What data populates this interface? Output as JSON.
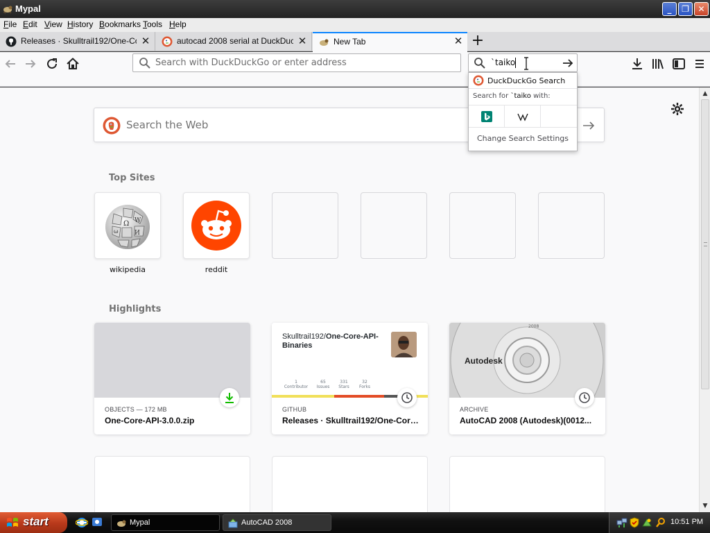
{
  "window": {
    "title": "Mypal"
  },
  "menu": [
    "File",
    "Edit",
    "View",
    "History",
    "Bookmarks",
    "Tools",
    "Help"
  ],
  "tabs": [
    {
      "label": "Releases · Skulltrail192/One-Core-",
      "icon": "github-icon"
    },
    {
      "label": "autocad 2008 serial at DuckDuckGo",
      "icon": "duckduckgo-icon"
    },
    {
      "label": "New Tab",
      "icon": "mypal-icon",
      "active": true
    }
  ],
  "navbar": {
    "url_placeholder": "Search with DuckDuckGo or enter address",
    "search_value": "`taiko"
  },
  "search_popup": {
    "engine_name": "DuckDuckGo Search",
    "search_for_prefix": "Search for",
    "search_for_term": "`taiko",
    "search_for_suffix": "with:",
    "engines": [
      "bing-icon",
      "wikipedia-icon",
      ""
    ],
    "change_settings": "Change Search Settings"
  },
  "newtab": {
    "web_search_placeholder": "Search the Web",
    "top_sites_title": "Top Sites",
    "top_sites": [
      {
        "label": "wikipedia",
        "icon": "wikipedia-globe-icon"
      },
      {
        "label": "reddit",
        "icon": "reddit-icon"
      },
      {
        "label": ""
      },
      {
        "label": ""
      },
      {
        "label": ""
      },
      {
        "label": ""
      }
    ],
    "highlights_title": "Highlights",
    "highlights": [
      {
        "context": "OBJECTS — 172 MB",
        "title": "One-Core-API-3.0.0.zip",
        "badge": "download-icon"
      },
      {
        "context": "GITHUB",
        "title": "Releases · Skulltrail192/One-Core-API-Binaries",
        "badge": "clock-icon",
        "thumb": {
          "owner": "Skulltrail192/",
          "repo": "One-Core-API-Binaries",
          "stats": [
            {
              "num": "1",
              "label": "Contributor"
            },
            {
              "num": "65",
              "label": "Issues"
            },
            {
              "num": "331",
              "label": "Stars"
            },
            {
              "num": "32",
              "label": "Forks"
            }
          ]
        }
      },
      {
        "context": "ARCHIVE",
        "title": "AutoCAD 2008 (Autodesk)(0012...",
        "badge": "clock-icon",
        "thumb": {
          "brand": "Autodesk",
          "year": "2008"
        }
      }
    ]
  },
  "taskbar": {
    "start_label": "start",
    "tasks": [
      {
        "label": "Mypal",
        "active": true
      },
      {
        "label": "AutoCAD 2008",
        "active": false
      }
    ],
    "clock": "10:51 PM"
  }
}
